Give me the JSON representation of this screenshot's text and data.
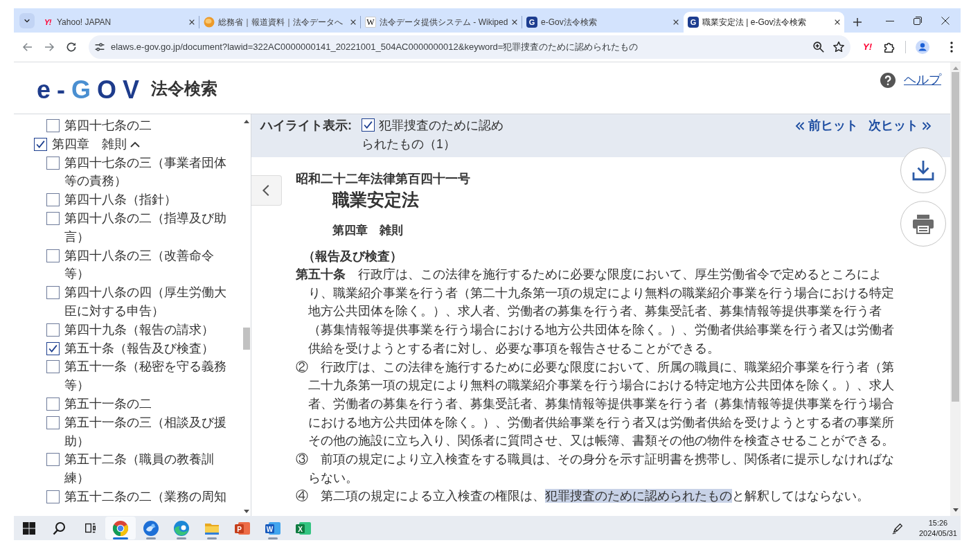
{
  "browser": {
    "tabs": [
      {
        "title": "Yahoo! JAPAN",
        "kind": "yahoo",
        "icon_text": "Y!",
        "selected": false
      },
      {
        "title": "総務省｜報道資料｜法令データへ",
        "kind": "ministry",
        "selected": false
      },
      {
        "title": "法令データ提供システム - Wikiped",
        "kind": "wikipedia",
        "icon_text": "W",
        "selected": false
      },
      {
        "title": "e-Gov法令検索",
        "kind": "egov",
        "icon_text": "G",
        "selected": false
      },
      {
        "title": "職業安定法 | e-Gov法令検索",
        "kind": "egov",
        "icon_text": "G",
        "selected": true
      }
    ],
    "address": "elaws.e-gov.go.jp/document?lawid=322AC0000000141_20221001_504AC0000000012&keyword=犯罪捜査のために認められたもの",
    "extension_text": "Y!"
  },
  "header": {
    "logo": "e-GOV",
    "site_name": "法令検索",
    "help": "ヘルプ"
  },
  "toc": [
    {
      "children": [
        {
          "label": "第四十七条の二",
          "checked": false
        }
      ]
    },
    {
      "label": "第四章　雑則",
      "checked": true,
      "expanded": true,
      "children": [
        {
          "label": "第四十七条の三（事業者団体等の責務）",
          "checked": false
        },
        {
          "label": "第四十八条（指針）",
          "checked": false
        },
        {
          "label": "第四十八条の二（指導及び助言）",
          "checked": false
        },
        {
          "label": "第四十八条の三（改善命令等）",
          "checked": false
        },
        {
          "label": "第四十八条の四（厚生労働大臣に対する申告）",
          "checked": false
        },
        {
          "label": "第四十九条（報告の請求）",
          "checked": false
        },
        {
          "label": "第五十条（報告及び検査）",
          "checked": true
        },
        {
          "label": "第五十一条（秘密を守る義務等）",
          "checked": false
        },
        {
          "label": "第五十一条の二",
          "checked": false
        },
        {
          "label": "第五十一条の三（相談及び援助）",
          "checked": false
        },
        {
          "label": "第五十二条（職員の教養訓練）",
          "checked": false
        },
        {
          "label": "第五十二条の二（業務の周知",
          "checked": false
        }
      ]
    }
  ],
  "highlight": {
    "label": "ハイライト表示:",
    "keywords": [
      {
        "text": "犯罪捜査のために認められたもの（1）",
        "checked": true
      }
    ],
    "prev": "前ヒット",
    "next": "次ヒット"
  },
  "law": {
    "number": "昭和二十二年法律第百四十一号",
    "title": "職業安定法",
    "chapter": "第四章　雑則",
    "caption": "（報告及び検査）",
    "paragraphs": [
      {
        "segments": [
          {
            "text": "**第五十条**　行政庁は、この法律を施行するために必要な限度において、厚生労働省令で定めるところにより、職業紹介事業を行う者（第二十九条第一項の規定により無料の職業紹介事業を行う場合における特定地方公共団体を除く。）、求人者、労働者の募集を行う者、募集受託者、募集情報等提供事業を行う者（募集情報等提供事業を行う場合における地方公共団体を除く。）、労働者供給事業を行う者又は労働者供給を受けようとする者に対し、必要な事項を報告させることができる。",
            "highlighted": false
          }
        ]
      },
      {
        "segments": [
          {
            "text": "②　行政庁は、この法律を施行するために必要な限度において、所属の職員に、職業紹介事業を行う者（第二十九条第一項の規定により無料の職業紹介事業を行う場合における特定地方公共団体を除く。）、求人者、労働者の募集を行う者、募集受託者、募集情報等提供事業を行う者（募集情報等提供事業を行う場合における地方公共団体を除く。）、労働者供給事業を行う者又は労働者供給を受けようとする者の事業所その他の施設に立ち入り、関係者に質問させ、又は帳簿、書類その他の物件を検査させることができる。",
            "highlighted": false
          }
        ]
      },
      {
        "segments": [
          {
            "text": "③　前項の規定により立入検査をする職員は、その身分を示す証明書を携帯し、関係者に提示しなければならない。",
            "highlighted": false
          }
        ]
      },
      {
        "segments": [
          {
            "text": "④　第二項の規定による立入検査の権限は、",
            "highlighted": false
          },
          {
            "text": "犯罪捜査のために認められたもの",
            "highlighted": true
          },
          {
            "text": "と解釈してはならない。",
            "highlighted": false
          }
        ]
      }
    ]
  },
  "taskbar": {
    "apps": [
      {
        "kind": "chrome",
        "running": true,
        "selected": true
      },
      {
        "kind": "thunderbird",
        "running": true,
        "selected": false
      },
      {
        "kind": "edge",
        "running": true,
        "selected": false
      },
      {
        "kind": "explorer",
        "running": true,
        "selected": false
      },
      {
        "kind": "powerpoint",
        "icon_text": "P",
        "running": false,
        "selected": false
      },
      {
        "kind": "word",
        "icon_text": "W",
        "running": true,
        "selected": false
      },
      {
        "kind": "excel",
        "icon_text": "X",
        "running": false,
        "selected": false
      }
    ],
    "time": "15:26",
    "date": "2024/05/31"
  }
}
